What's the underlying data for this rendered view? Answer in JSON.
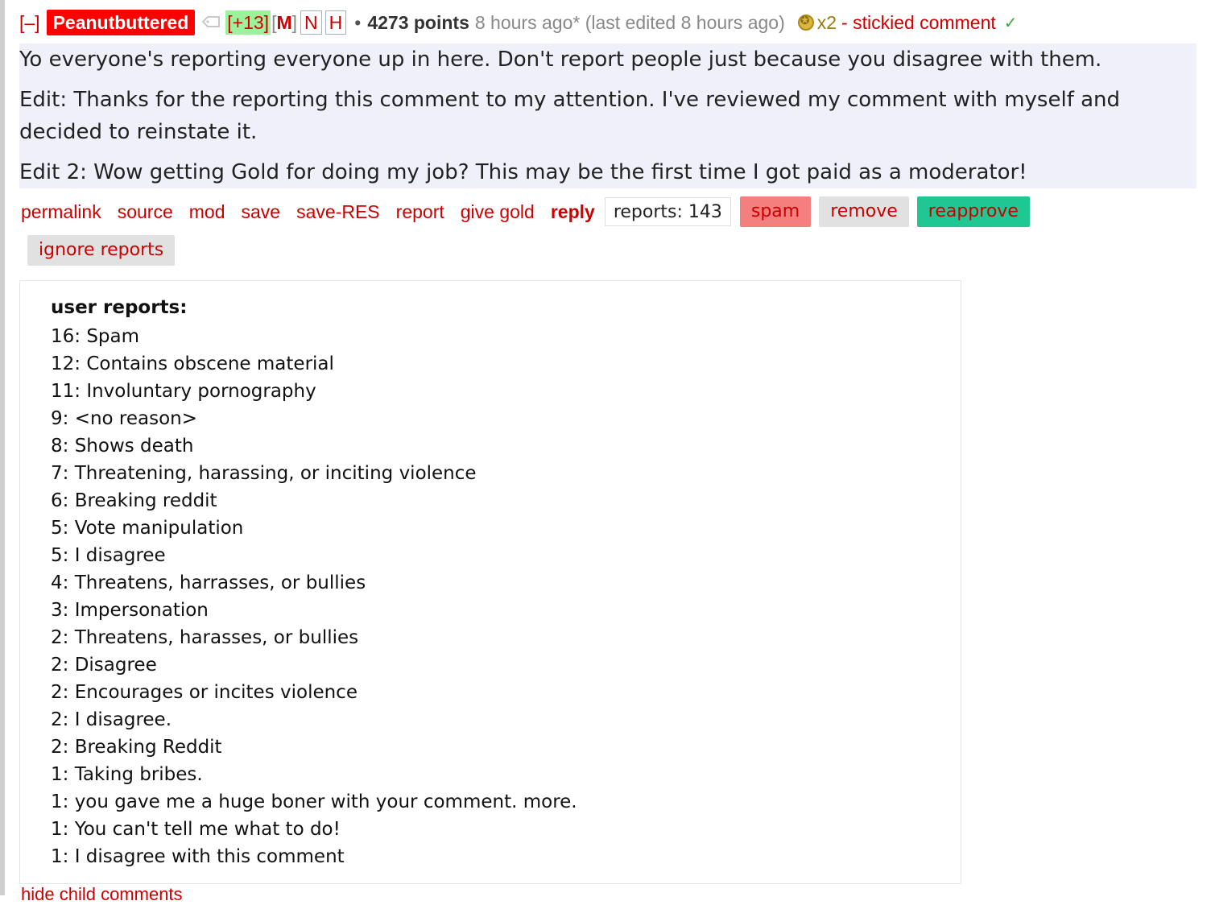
{
  "comment": {
    "collapse_label": "[–]",
    "author": "Peanutbuttered",
    "tag_icon": "tag-icon",
    "karma": "[+13]",
    "flair_m": "M",
    "flair_n": "N",
    "flair_h": "H",
    "separator": "•",
    "points": "4273 points",
    "age": "8 hours ago* (last edited 8 hours ago)",
    "gold_icon": "gold-award-icon",
    "gold_count": "x2",
    "stickied": "- stickied comment",
    "approved_icon": "checkmark-icon",
    "body": [
      "Yo everyone's reporting everyone up in here. Don't report people just because you disagree with them.",
      "Edit: Thanks for the reporting this comment to my attention. I've reviewed my comment with myself and decided to reinstate it.",
      "Edit 2: Wow getting Gold for doing my job? This may be the first time I got paid as a moderator!"
    ]
  },
  "actions": {
    "permalink": "permalink",
    "source": "source",
    "mod": "mod",
    "save": "save",
    "save_res": "save-RES",
    "report": "report",
    "give_gold": "give gold",
    "reply": "reply",
    "reports_count": "reports: 143",
    "spam": "spam",
    "remove": "remove",
    "reapprove": "reapprove",
    "ignore_reports": "ignore reports"
  },
  "user_reports": {
    "title": "user reports:",
    "items": [
      "16: Spam",
      "12: Contains obscene material",
      "11: Involuntary pornography",
      "9: <no reason>",
      "8: Shows death",
      "7: Threatening, harassing, or inciting violence",
      "6: Breaking reddit",
      "5: Vote manipulation",
      "5: I disagree",
      "4: Threatens, harrasses, or bullies",
      "3: Impersonation",
      "2: Threatens, harasses, or bullies",
      "2: Disagree",
      "2: Encourages or incites violence",
      "2: I disagree.",
      "2: Breaking Reddit",
      "1: Taking bribes.",
      "1: you gave me a huge boner with your comment. more.",
      "1: You can't tell me what to do!",
      "1: I disagree with this comment"
    ]
  },
  "footer": {
    "hide_child": "hide child comments"
  },
  "colors": {
    "link_red": "#cc0000",
    "author_bg": "#ff0000",
    "karma_bg": "#9cf29c",
    "body_bg": "#eff0fa",
    "spam_bg": "#f47f7f",
    "reapprove_bg": "#1fc793",
    "neutral_btn_bg": "#e1e1e1"
  }
}
